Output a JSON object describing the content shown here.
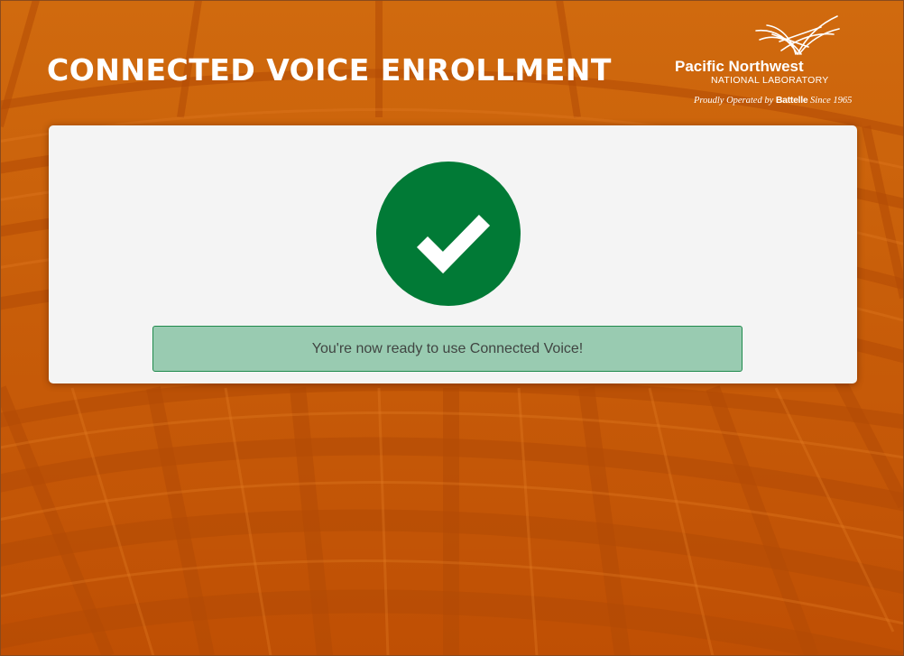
{
  "header": {
    "title": "CONNECTED VOICE ENROLLMENT"
  },
  "logo": {
    "name": "Pacific Northwest",
    "subname": "NATIONAL LABORATORY",
    "tagline_prefix": "Proudly Operated by",
    "tagline_brand": "Battelle",
    "tagline_suffix": "Since 1965"
  },
  "status": {
    "icon": "checkmark-icon",
    "message": "You're now ready to use Connected Voice!"
  },
  "colors": {
    "background": "#c85a08",
    "card": "#f4f4f4",
    "success_circle": "#017a36",
    "alert_background": "#99cbb1",
    "alert_border": "#1f8a4c"
  }
}
